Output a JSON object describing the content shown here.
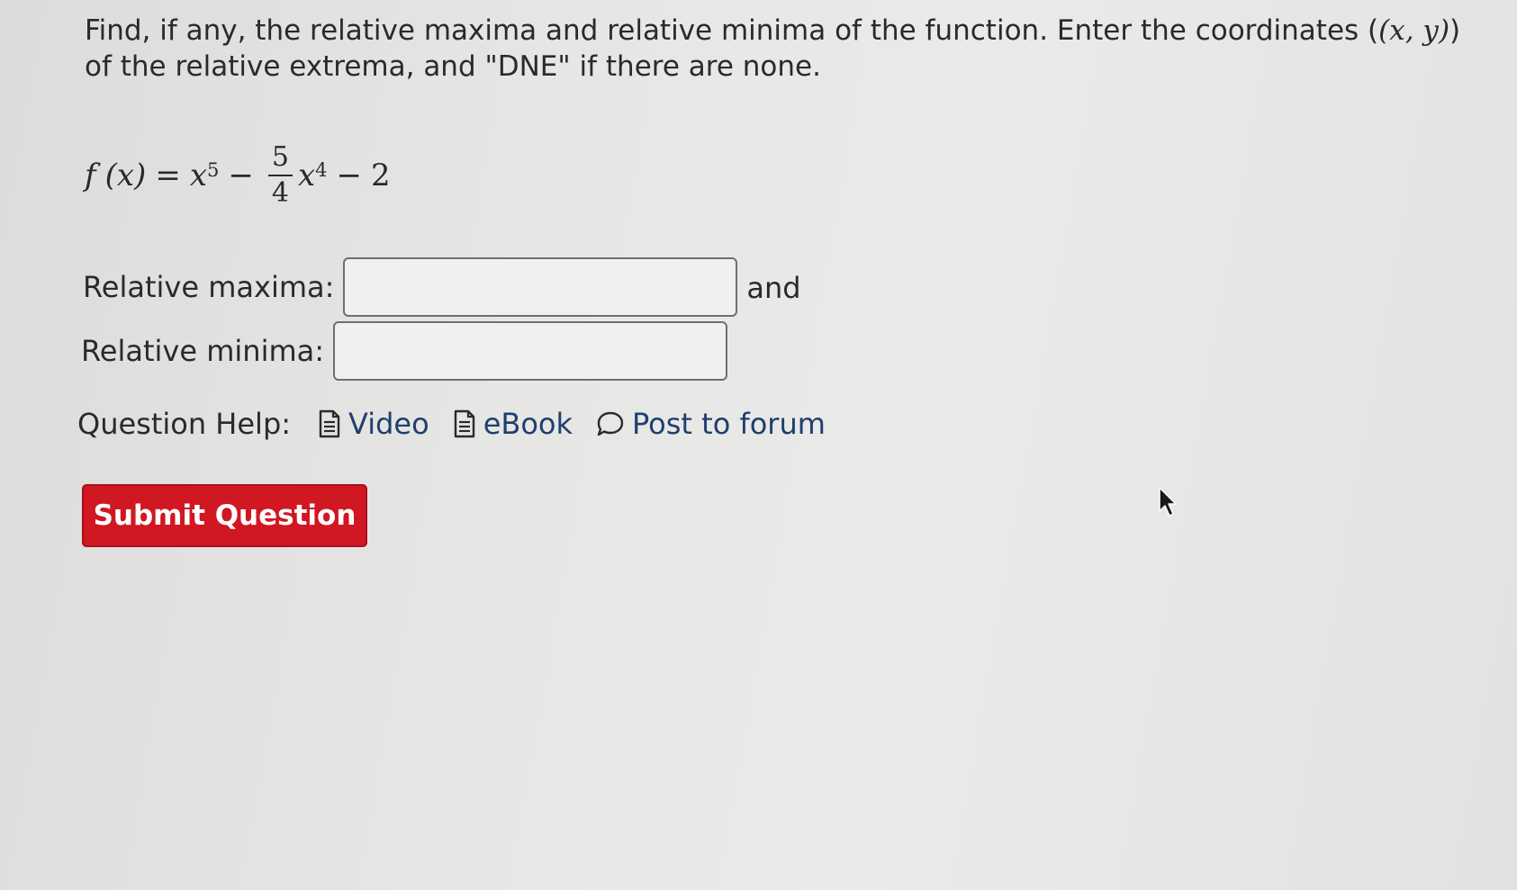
{
  "prompt": {
    "text_before": "Find, if any, the relative maxima and relative minima of the function. Enter the coordinates (",
    "coord_math": "(x, y)",
    "text_after": ") of the relative extrema, and \"DNE\" if there are none."
  },
  "equation": {
    "lhs_fn": "f",
    "lhs_arg": "(x)",
    "equals": "=",
    "term1_base": "x",
    "term1_exp": "5",
    "minus1": "−",
    "frac_num": "5",
    "frac_den": "4",
    "term2_base": "x",
    "term2_exp": "4",
    "minus2": "−",
    "constant": "2"
  },
  "answers": {
    "max_label": "Relative maxima:",
    "max_value": "",
    "and_label": "and",
    "min_label": "Relative minima:",
    "min_value": ""
  },
  "help": {
    "label": "Question Help:",
    "video": "Video",
    "ebook": "eBook",
    "forum": "Post to forum",
    "link_color": "#1f3f6e"
  },
  "submit": {
    "label": "Submit Question",
    "color": "#d01722"
  }
}
